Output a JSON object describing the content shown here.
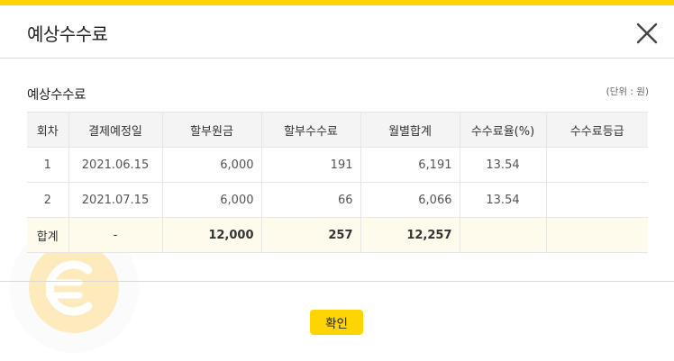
{
  "modal": {
    "title": "예상수수료"
  },
  "section": {
    "title": "예상수수료",
    "unit": "(단위 : 원)"
  },
  "table": {
    "headers": [
      "회차",
      "결제예정일",
      "할부원금",
      "할부수수료",
      "월별합계",
      "수수료율(%)",
      "수수료등급"
    ],
    "rows": [
      [
        "1",
        "2021.06.15",
        "6,000",
        "191",
        "6,191",
        "13.54",
        ""
      ],
      [
        "2",
        "2021.07.15",
        "6,000",
        "66",
        "6,066",
        "13.54",
        ""
      ]
    ],
    "total": [
      "합계",
      "-",
      "12,000",
      "257",
      "12,257",
      "",
      ""
    ]
  },
  "footer": {
    "confirm_label": "확인"
  },
  "icons": {
    "close": "close-icon",
    "watermark": "euro-coin-icon"
  },
  "colors": {
    "accent": "#ffd400",
    "total_row_bg": "#fffbec",
    "header_bg": "#f4f4f4"
  }
}
